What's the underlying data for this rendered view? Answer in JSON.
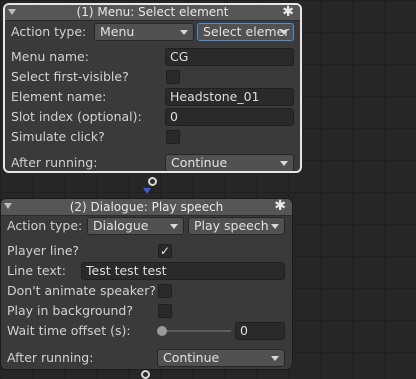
{
  "node1": {
    "title": "(1) Menu: Select element",
    "action_type_label": "Action type:",
    "action_type_value": "Menu",
    "action_value": "Select elemer",
    "menu_name_label": "Menu name:",
    "menu_name_value": "CG",
    "select_first_visible_label": "Select first-visible?",
    "select_first_visible_checked": false,
    "element_name_label": "Element name:",
    "element_name_value": "Headstone_01",
    "slot_index_label": "Slot index (optional):",
    "slot_index_value": "0",
    "simulate_click_label": "Simulate click?",
    "simulate_click_checked": false,
    "after_running_label": "After running:",
    "after_running_value": "Continue"
  },
  "node2": {
    "title": "(2) Dialogue: Play speech",
    "action_type_label": "Action type:",
    "action_type_value": "Dialogue",
    "action_value": "Play speech",
    "player_line_label": "Player line?",
    "player_line_checked": true,
    "player_line_check_glyph": "✓",
    "line_text_label": "Line text:",
    "line_text_value": "Test test test",
    "dont_animate_label": "Don't animate speaker?",
    "dont_animate_checked": false,
    "play_background_label": "Play in background?",
    "play_background_checked": false,
    "wait_offset_label": "Wait time offset (s):",
    "wait_offset_value": "0",
    "after_running_label": "After running:",
    "after_running_value": "Continue"
  },
  "icons": {
    "gear": "✱"
  },
  "colors": {
    "selection_border": "#e6e6e6",
    "focus_border": "#4d8fd6",
    "connector_arrow": "#3f5bd6"
  }
}
